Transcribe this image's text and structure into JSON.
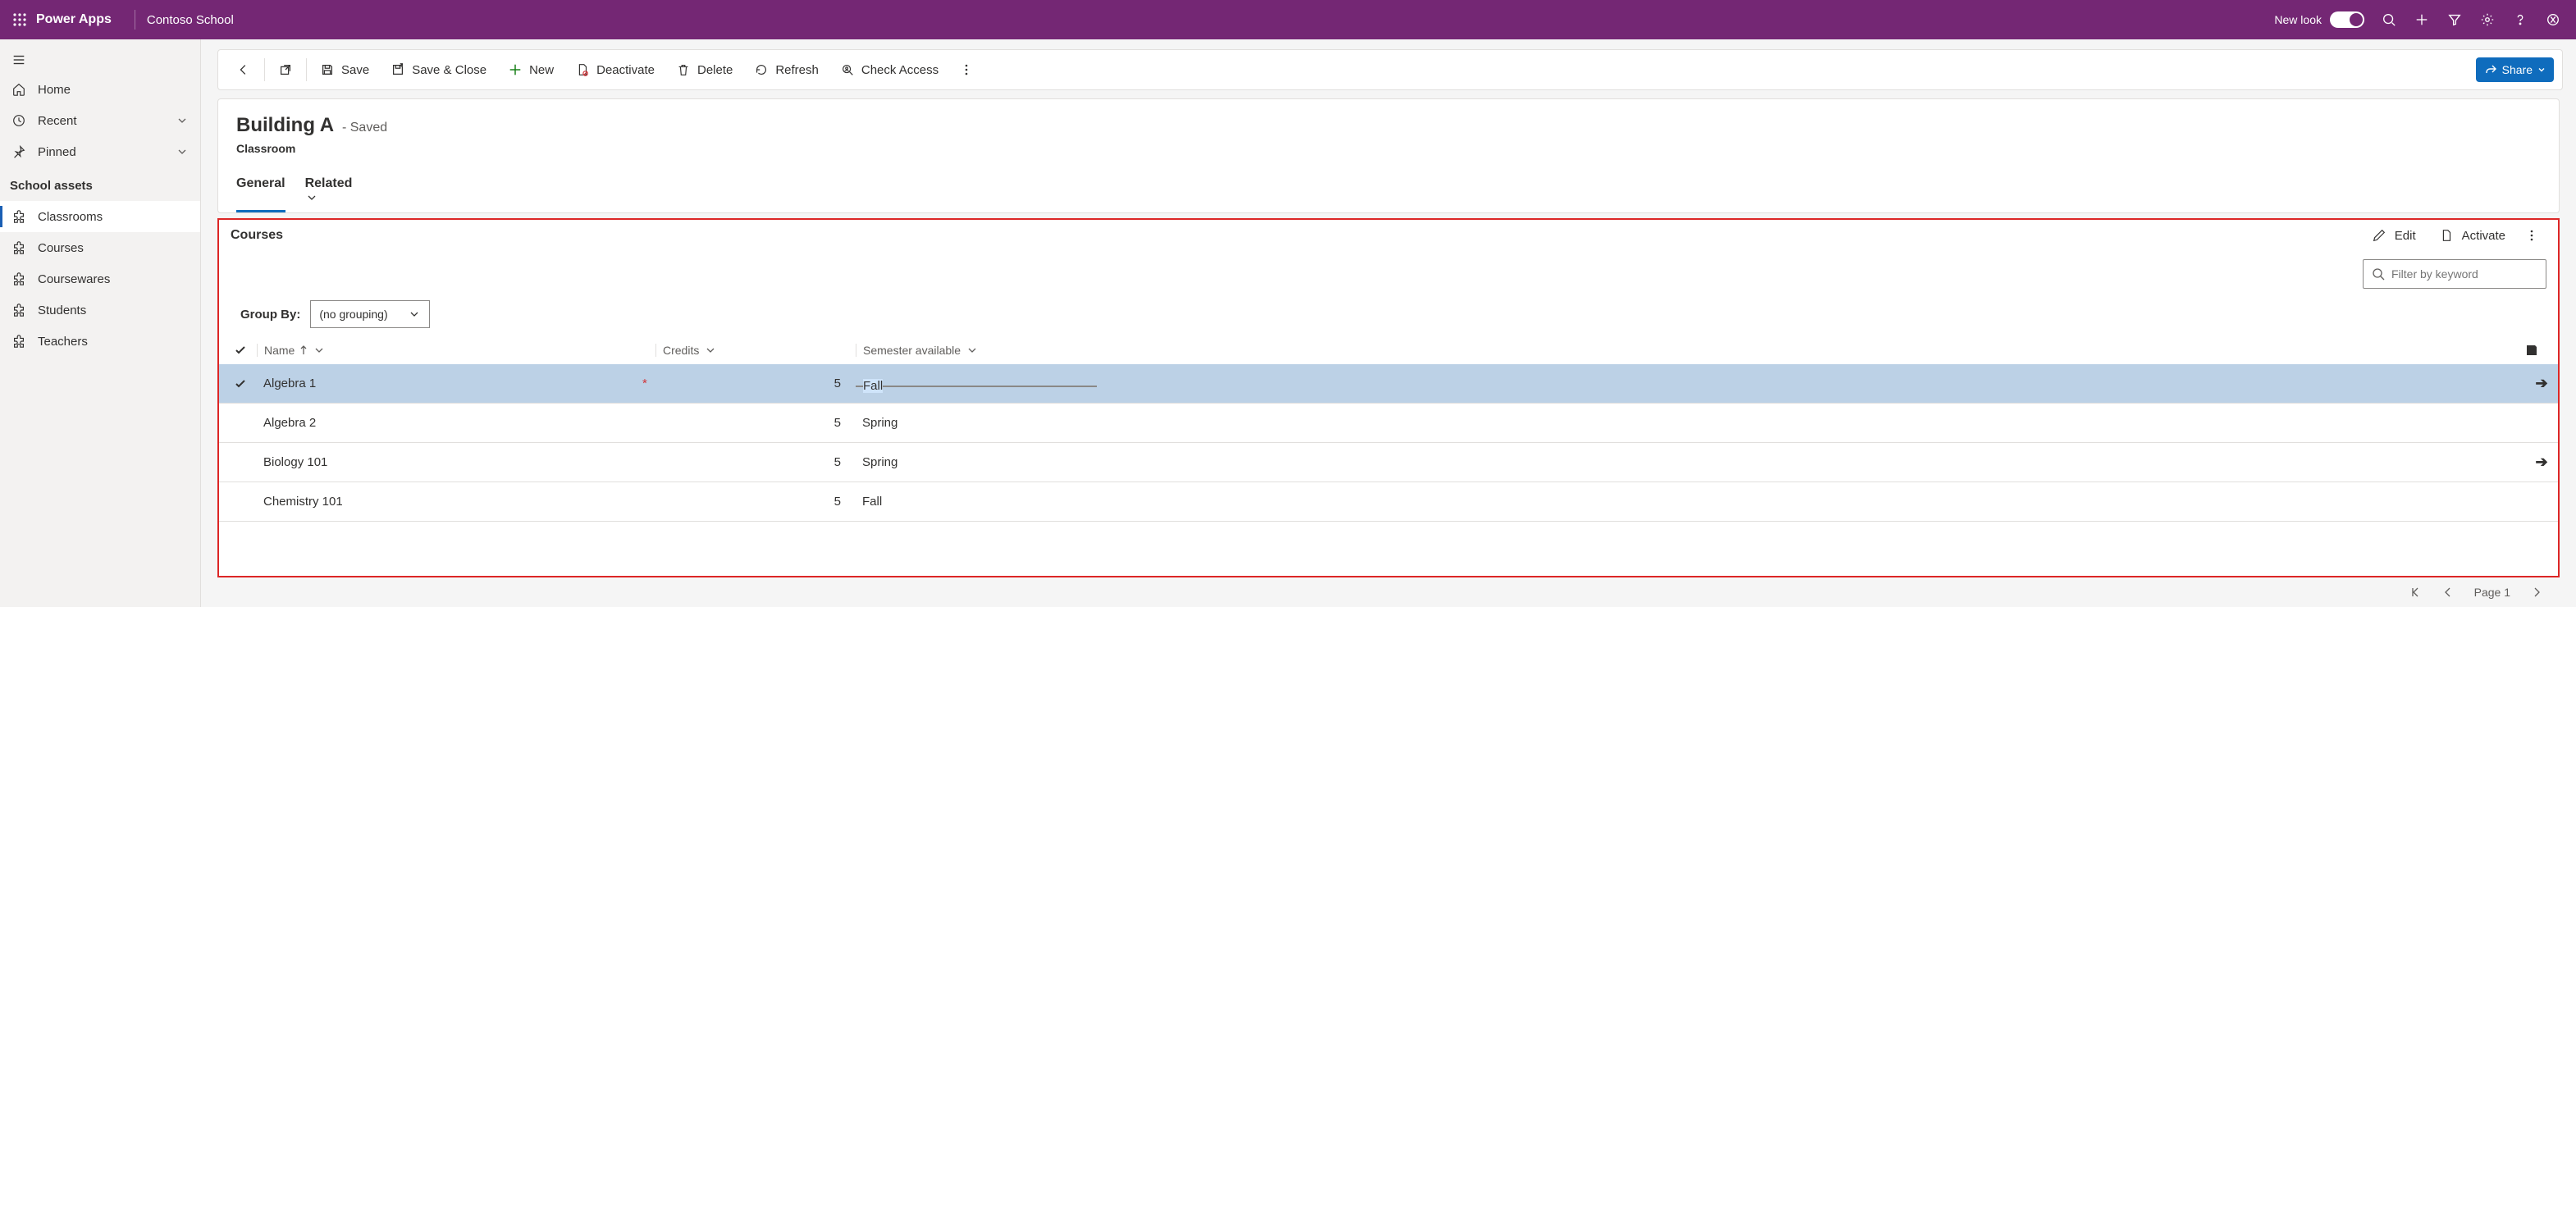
{
  "header": {
    "brand": "Power Apps",
    "app_name": "Contoso School",
    "new_look_label": "New look"
  },
  "sidebar": {
    "home": "Home",
    "recent": "Recent",
    "pinned": "Pinned",
    "section": "School assets",
    "items": [
      {
        "label": "Classrooms",
        "active": true
      },
      {
        "label": "Courses"
      },
      {
        "label": "Coursewares"
      },
      {
        "label": "Students"
      },
      {
        "label": "Teachers"
      }
    ]
  },
  "commandbar": {
    "save": "Save",
    "save_close": "Save & Close",
    "new": "New",
    "deactivate": "Deactivate",
    "delete": "Delete",
    "refresh": "Refresh",
    "check_access": "Check Access",
    "share": "Share"
  },
  "record": {
    "title": "Building A",
    "saved_suffix": "- Saved",
    "entity": "Classroom",
    "tabs": {
      "general": "General",
      "related": "Related"
    }
  },
  "subgrid": {
    "title": "Courses",
    "edit": "Edit",
    "activate": "Activate",
    "filter_placeholder": "Filter by keyword",
    "groupby_label": "Group By:",
    "groupby_value": "(no grouping)",
    "columns": {
      "name": "Name",
      "credits": "Credits",
      "semester": "Semester available"
    },
    "rows": [
      {
        "name": "Algebra 1",
        "credits": "5",
        "semester": "Fall",
        "selected": true,
        "required": true,
        "arrow": true
      },
      {
        "name": "Algebra 2",
        "credits": "5",
        "semester": "Spring",
        "selected": false,
        "required": false,
        "arrow": false
      },
      {
        "name": "Biology 101",
        "credits": "5",
        "semester": "Spring",
        "selected": false,
        "required": false,
        "arrow": true
      },
      {
        "name": "Chemistry 101",
        "credits": "5",
        "semester": "Fall",
        "selected": false,
        "required": false,
        "arrow": false
      }
    ]
  },
  "pager": {
    "page_label": "Page 1"
  }
}
